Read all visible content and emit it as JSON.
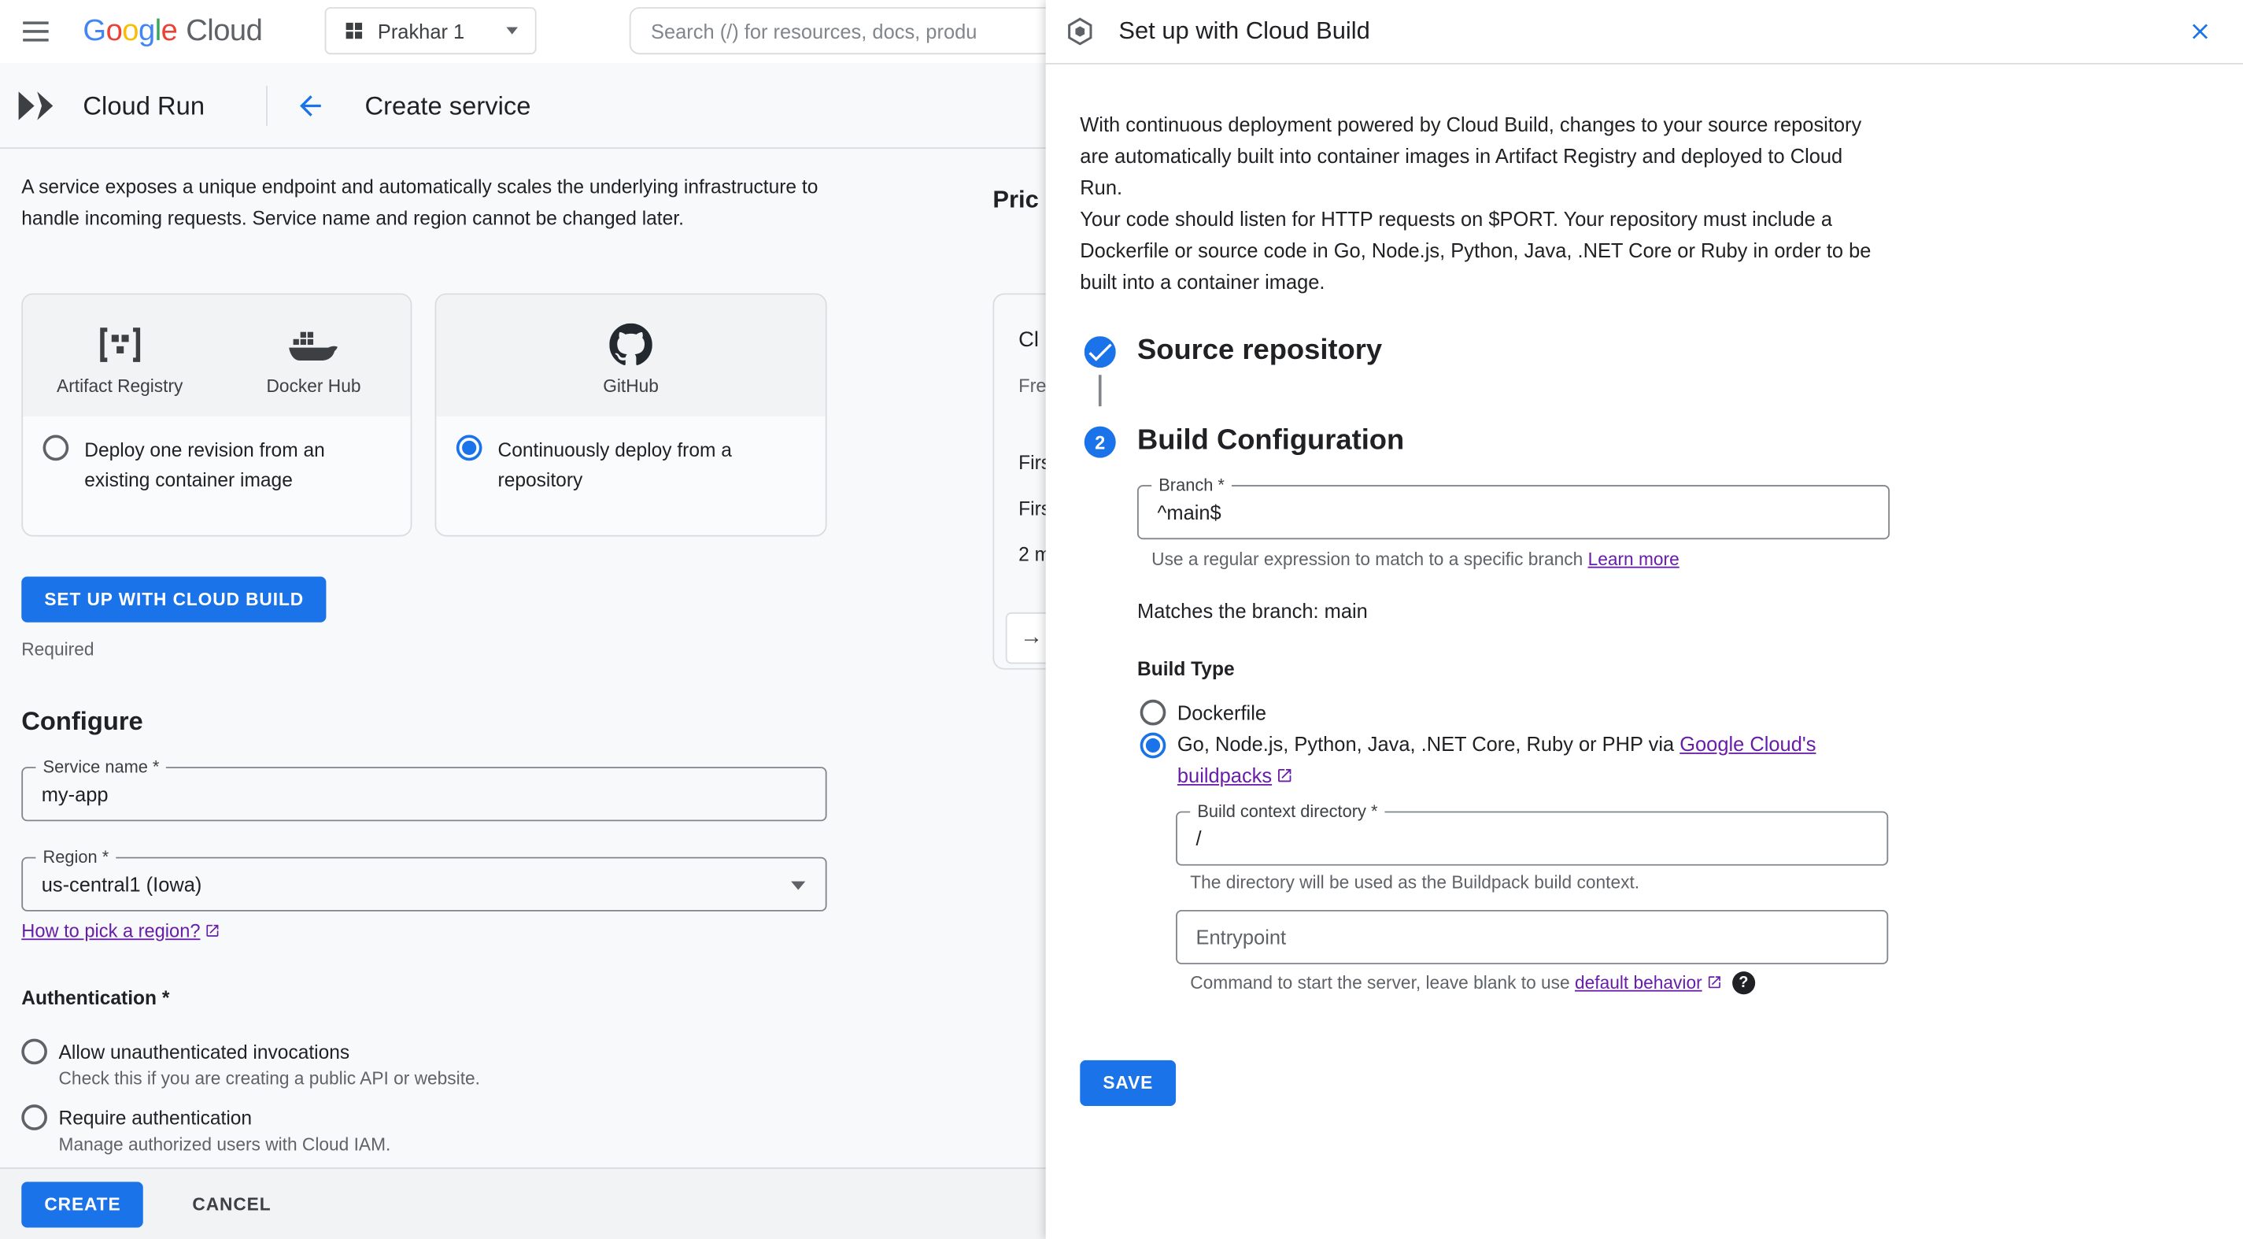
{
  "colors": {
    "primary": "#1a73e8",
    "link_visited": "#681da8",
    "text_primary": "#202124",
    "text_secondary": "#5f6368",
    "border": "#dadce0",
    "google_letters": [
      {
        "ch": "G",
        "color": "#4285F4"
      },
      {
        "ch": "o",
        "color": "#EA4335"
      },
      {
        "ch": "o",
        "color": "#FBBC04"
      },
      {
        "ch": "g",
        "color": "#4285F4"
      },
      {
        "ch": "l",
        "color": "#34A853"
      },
      {
        "ch": "e",
        "color": "#EA4335"
      }
    ]
  },
  "icons": {
    "arrow_right": "→",
    "help": "?"
  },
  "topbar": {
    "logo_cloud": "Cloud",
    "project_name": "Prakhar 1",
    "search_placeholder": "Search (/) for resources, docs, produ"
  },
  "header": {
    "product": "Cloud Run",
    "title": "Create service"
  },
  "main": {
    "intro": "A service exposes a unique endpoint and automatically scales the underlying infrastructure to handle incoming requests. Service name and region cannot be changed later.",
    "card_registry": {
      "option1": "Artifact Registry",
      "option2": "Docker Hub",
      "radio_label": "Deploy one revision from an existing container image"
    },
    "card_repo": {
      "option1": "GitHub",
      "radio_label": "Continuously deploy from a repository"
    },
    "setup_button": "SET UP WITH CLOUD BUILD",
    "required": "Required",
    "configure_heading": "Configure",
    "service_name": {
      "label": "Service name *",
      "value": "my-app"
    },
    "region": {
      "label": "Region *",
      "value": "us-central1 (Iowa)"
    },
    "region_link": "How to pick a region?",
    "auth_heading": "Authentication *",
    "auth_option1": {
      "label": "Allow unauthenticated invocations",
      "description": "Check this if you are creating a public API or website."
    },
    "auth_option2": {
      "label": "Require authentication",
      "description": "Manage authorized users with Cloud IAM."
    },
    "create_button": "CREATE",
    "cancel_button": "CANCEL"
  },
  "pricing": {
    "heading": "Pric",
    "card_title": "Cl",
    "card_subtitle": "Fre",
    "row1": "Firs",
    "row2": "Firs",
    "row3": "2 m"
  },
  "panel": {
    "title": "Set up with Cloud Build",
    "intro1": "With continuous deployment powered by Cloud Build, changes to your source repository are automatically built into container images in Artifact Registry and deployed to Cloud Run.",
    "intro2": "Your code should listen for HTTP requests on $PORT. Your repository must include a Dockerfile or source code in Go, Node.js, Python, Java, .NET Core or Ruby in order to be built into a container image.",
    "step1_title": "Source repository",
    "step2_number": "2",
    "step2_title": "Build Configuration",
    "branch": {
      "label": "Branch *",
      "value": "^main$"
    },
    "branch_helper": "Use a regular expression to match to a specific branch ",
    "branch_helper_link": "Learn more",
    "match_text": "Matches the branch: main",
    "build_type_label": "Build Type",
    "build_type_option1": "Dockerfile",
    "build_type_option2_prefix": "Go, Node.js, Python, Java, .NET Core, Ruby or PHP via ",
    "build_type_option2_link": "Google Cloud's buildpacks",
    "context_dir": {
      "label": "Build context directory *",
      "value": "/"
    },
    "context_helper": "The directory will be used as the Buildpack build context.",
    "entrypoint_label": "Entrypoint",
    "entrypoint_helper": "Command to start the server, leave blank to use ",
    "entrypoint_helper_link": "default behavior",
    "save_button": "SAVE"
  }
}
